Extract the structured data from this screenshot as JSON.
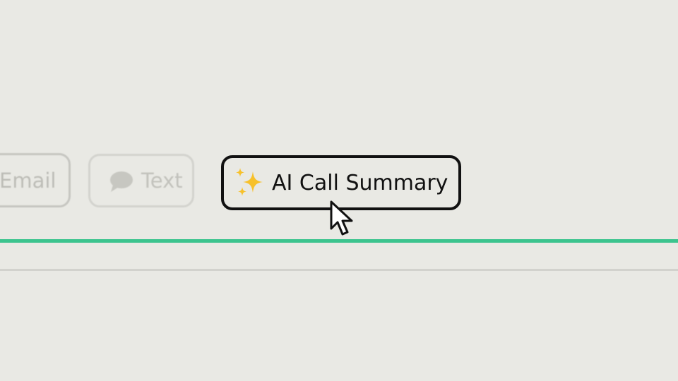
{
  "tabs": {
    "email_label": "Email",
    "text_label": "Text",
    "ai_summary_label": "AI Call Summary"
  },
  "icons": {
    "text_icon": "chat-bubble-icon",
    "ai_icon": "sparkles-icon",
    "pointer": "mouse-pointer-icon"
  },
  "colors": {
    "background": "#e9e9e4",
    "accent_line": "#3cc48e",
    "active_border": "#111111",
    "inactive_text": "#c2c2bc",
    "sparkle": "#f7c12b"
  }
}
